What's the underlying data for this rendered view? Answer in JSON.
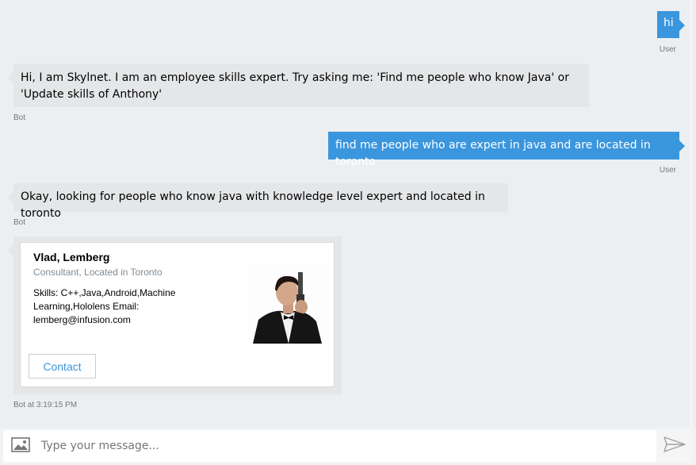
{
  "messages": [
    {
      "from": "user",
      "text": "hi",
      "meta": "User"
    },
    {
      "from": "bot",
      "text": "Hi, I am Skylnet. I am an employee skills expert. Try asking me: 'Find me people who know Java' or 'Update skills of Anthony'",
      "meta": "Bot"
    },
    {
      "from": "user",
      "text": "find me people who are expert in java and are located in toronto",
      "meta": "User"
    },
    {
      "from": "bot",
      "text": "Okay, looking for people who know java with knowledge level expert and located in toronto",
      "meta": "Bot"
    }
  ],
  "card": {
    "name": "Vlad, Lemberg",
    "subtitle": "Consultant, Located in Toronto",
    "text": "Skills: C++,Java,Android,Machine Learning,Hololens Email: lemberg@infusion.com",
    "contact_label": "Contact",
    "meta": "Bot at 3:19:15 PM"
  },
  "input": {
    "placeholder": "Type your message..."
  },
  "colors": {
    "user_bubble": "#3a96dd",
    "bot_bubble": "#e4e6e8",
    "background": "#eceff1"
  },
  "icons": {
    "upload": "image-upload-icon",
    "send": "send-icon"
  }
}
